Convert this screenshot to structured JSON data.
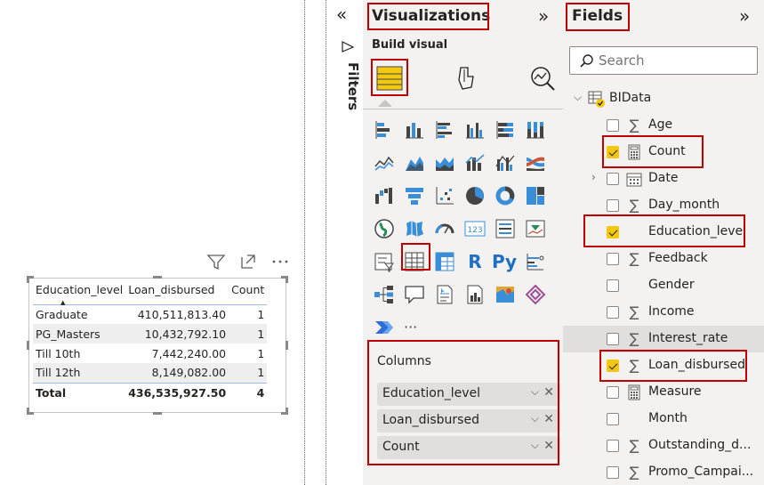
{
  "canvas": {
    "visual_header_icons": [
      "filter-icon",
      "focus-mode-icon",
      "more-options-icon"
    ],
    "table": {
      "columns": [
        "Education_level",
        "Loan_disbursed",
        "Count"
      ],
      "rows": [
        [
          "Graduate",
          "410,511,813.40",
          "1"
        ],
        [
          "PG_Masters",
          "10,432,792.10",
          "1"
        ],
        [
          "Till 10th",
          "7,442,240.00",
          "1"
        ],
        [
          "Till 12th",
          "8,149,082.00",
          "1"
        ]
      ],
      "total": [
        "Total",
        "436,535,927.50",
        "4"
      ]
    }
  },
  "filters": {
    "title": "Filters",
    "collapse_glyph": "«"
  },
  "visualizations": {
    "title": "Visualizations",
    "expand_glyph": "»",
    "build_visual_label": "Build visual",
    "text_icons": {
      "r": "R",
      "py": "Py",
      "more": "···"
    },
    "columns_label": "Columns",
    "column_pills": [
      "Education_level",
      "Loan_disbursed",
      "Count"
    ]
  },
  "fields": {
    "title": "Fields",
    "expand_glyph": "»",
    "search_placeholder": "Search",
    "table_name": "BIData",
    "items": [
      {
        "name": "Age",
        "sigma": true,
        "checked": false
      },
      {
        "name": "Count",
        "sigma": false,
        "checked": true
      },
      {
        "name": "Date",
        "sigma": false,
        "checked": false
      },
      {
        "name": "Day_month",
        "sigma": true,
        "checked": false
      },
      {
        "name": "Education_level",
        "sigma": false,
        "checked": true
      },
      {
        "name": "Feedback",
        "sigma": true,
        "checked": false
      },
      {
        "name": "Gender",
        "sigma": false,
        "checked": false
      },
      {
        "name": "Income",
        "sigma": true,
        "checked": false
      },
      {
        "name": "Interest_rate",
        "sigma": true,
        "checked": false
      },
      {
        "name": "Loan_disbursed",
        "sigma": true,
        "checked": true
      },
      {
        "name": "Measure",
        "sigma": false,
        "checked": false
      },
      {
        "name": "Month",
        "sigma": false,
        "checked": false
      },
      {
        "name": "Outstanding_d...",
        "sigma": true,
        "checked": false
      },
      {
        "name": "Promo_Campai...",
        "sigma": true,
        "checked": false
      }
    ]
  },
  "colors": {
    "accent_yellow": "#f2c811",
    "highlight_red": "#c00000",
    "pane_bg": "#f3f2f1",
    "header_rule": "#9bc2e6"
  }
}
